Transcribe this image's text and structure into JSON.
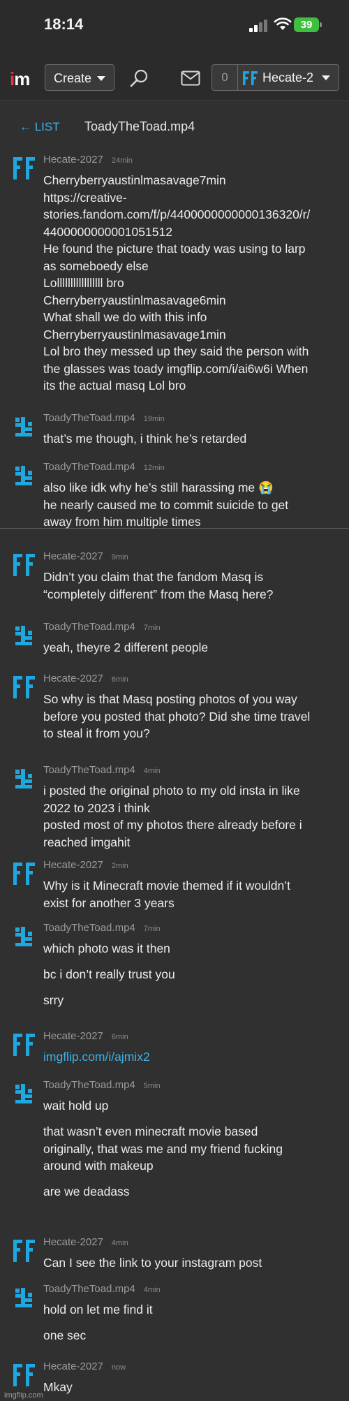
{
  "status_bar": {
    "time": "18:14",
    "battery": "39"
  },
  "nav": {
    "logo_i": "i",
    "logo_m": "m",
    "create_label": "Create",
    "notification_count": "0",
    "account_name": "Hecate-2"
  },
  "conversation": {
    "back_label": "← LIST",
    "title": "TOADYTHETOAD.MP4_display",
    "title_text": "ToadyTheToad.mp4"
  },
  "colors": {
    "accent": "#3db0e6",
    "logo_red": "#e53939",
    "battery_green": "#3fbf3f"
  },
  "messages": [
    {
      "user": "Hecate-2027",
      "ago": "24min",
      "avatar": "ff-icon",
      "lines": [
        "Cherryberryaustinlmasavage7min",
        "https://creative-",
        "stories.fandom.com/f/p/4400000000000136320/r/",
        "4400000000001051512",
        "He found the picture that toady was using to larp",
        "as someboedy else",
        "Lolllllllllllllllll bro",
        "Cherryberryaustinlmasavage6min",
        "What shall we do with this info",
        "Cherryberryaustinlmasavage1min",
        "Lol bro they messed up they said the person with",
        "the glasses was toady imgflip.com/i/ai6w6i When",
        "its the actual masq Lol bro"
      ]
    },
    {
      "user": "ToadyTheToad.mp4",
      "ago": "19min",
      "avatar": "toad-icon",
      "lines": [
        "that’s me though, i think he’s retarded"
      ]
    },
    {
      "user": "ToadyTheToad.mp4",
      "ago": "12min",
      "avatar": "toad-icon",
      "lines": [
        "also like idk why he’s still harassing me 😭",
        "he nearly caused me to commit suicide to get",
        "away from him multiple times"
      ]
    },
    {
      "user": "Hecate-2027",
      "ago": "9min",
      "avatar": "ff-icon",
      "lines": [
        "Didn’t you claim that the fandom Masq is",
        "“completely different” from the Masq here?"
      ]
    },
    {
      "user": "ToadyTheToad.mp4",
      "ago": "7min",
      "avatar": "toad-icon",
      "lines": [
        "yeah, theyre 2 different people"
      ]
    },
    {
      "user": "Hecate-2027",
      "ago": "6min",
      "avatar": "ff-icon",
      "lines": [
        "So why is that Masq posting photos of you way",
        "before you posted that photo? Did she time travel",
        "to steal it from you?"
      ]
    },
    {
      "user": "ToadyTheToad.mp4",
      "ago": "4min",
      "avatar": "toad-icon",
      "lines": [
        "i posted the original photo to my old insta in like",
        "2022 to 2023 i think",
        "posted most of my photos there already before i",
        "reached imgahit"
      ]
    },
    {
      "user": "Hecate-2027",
      "ago": "2min",
      "avatar": "ff-icon",
      "lines": [
        "Why is it Minecraft movie themed if it wouldn’t",
        "exist for another 3 years"
      ]
    },
    {
      "user": "ToadyTheToad.mp4",
      "ago": "7min",
      "avatar": "toad-icon",
      "lines": [
        "which photo was it then",
        "bc i don’t really trust you",
        "srry"
      ]
    },
    {
      "user": "Hecate-2027",
      "ago": "6min",
      "avatar": "ff-icon",
      "link": "imgflip.com/i/ajmix2"
    },
    {
      "user": "ToadyTheToad.mp4",
      "ago": "5min",
      "avatar": "toad-icon",
      "lines": [
        "wait hold up",
        "that wasn’t even minecraft movie based",
        "originally, that was me and my friend fucking",
        "around with makeup",
        "are we deadass"
      ]
    },
    {
      "user": "Hecate-2027",
      "ago": "4min",
      "avatar": "ff-icon",
      "lines": [
        "Can I see the link to your instagram post"
      ]
    },
    {
      "user": "ToadyTheToad.mp4",
      "ago": "4min",
      "avatar": "toad-icon",
      "lines": [
        "hold on let me find it",
        "one sec"
      ]
    },
    {
      "user": "Hecate-2027",
      "ago": "now",
      "avatar": "ff-icon",
      "lines": [
        "Mkay"
      ]
    }
  ],
  "footer": "imgflip.com"
}
